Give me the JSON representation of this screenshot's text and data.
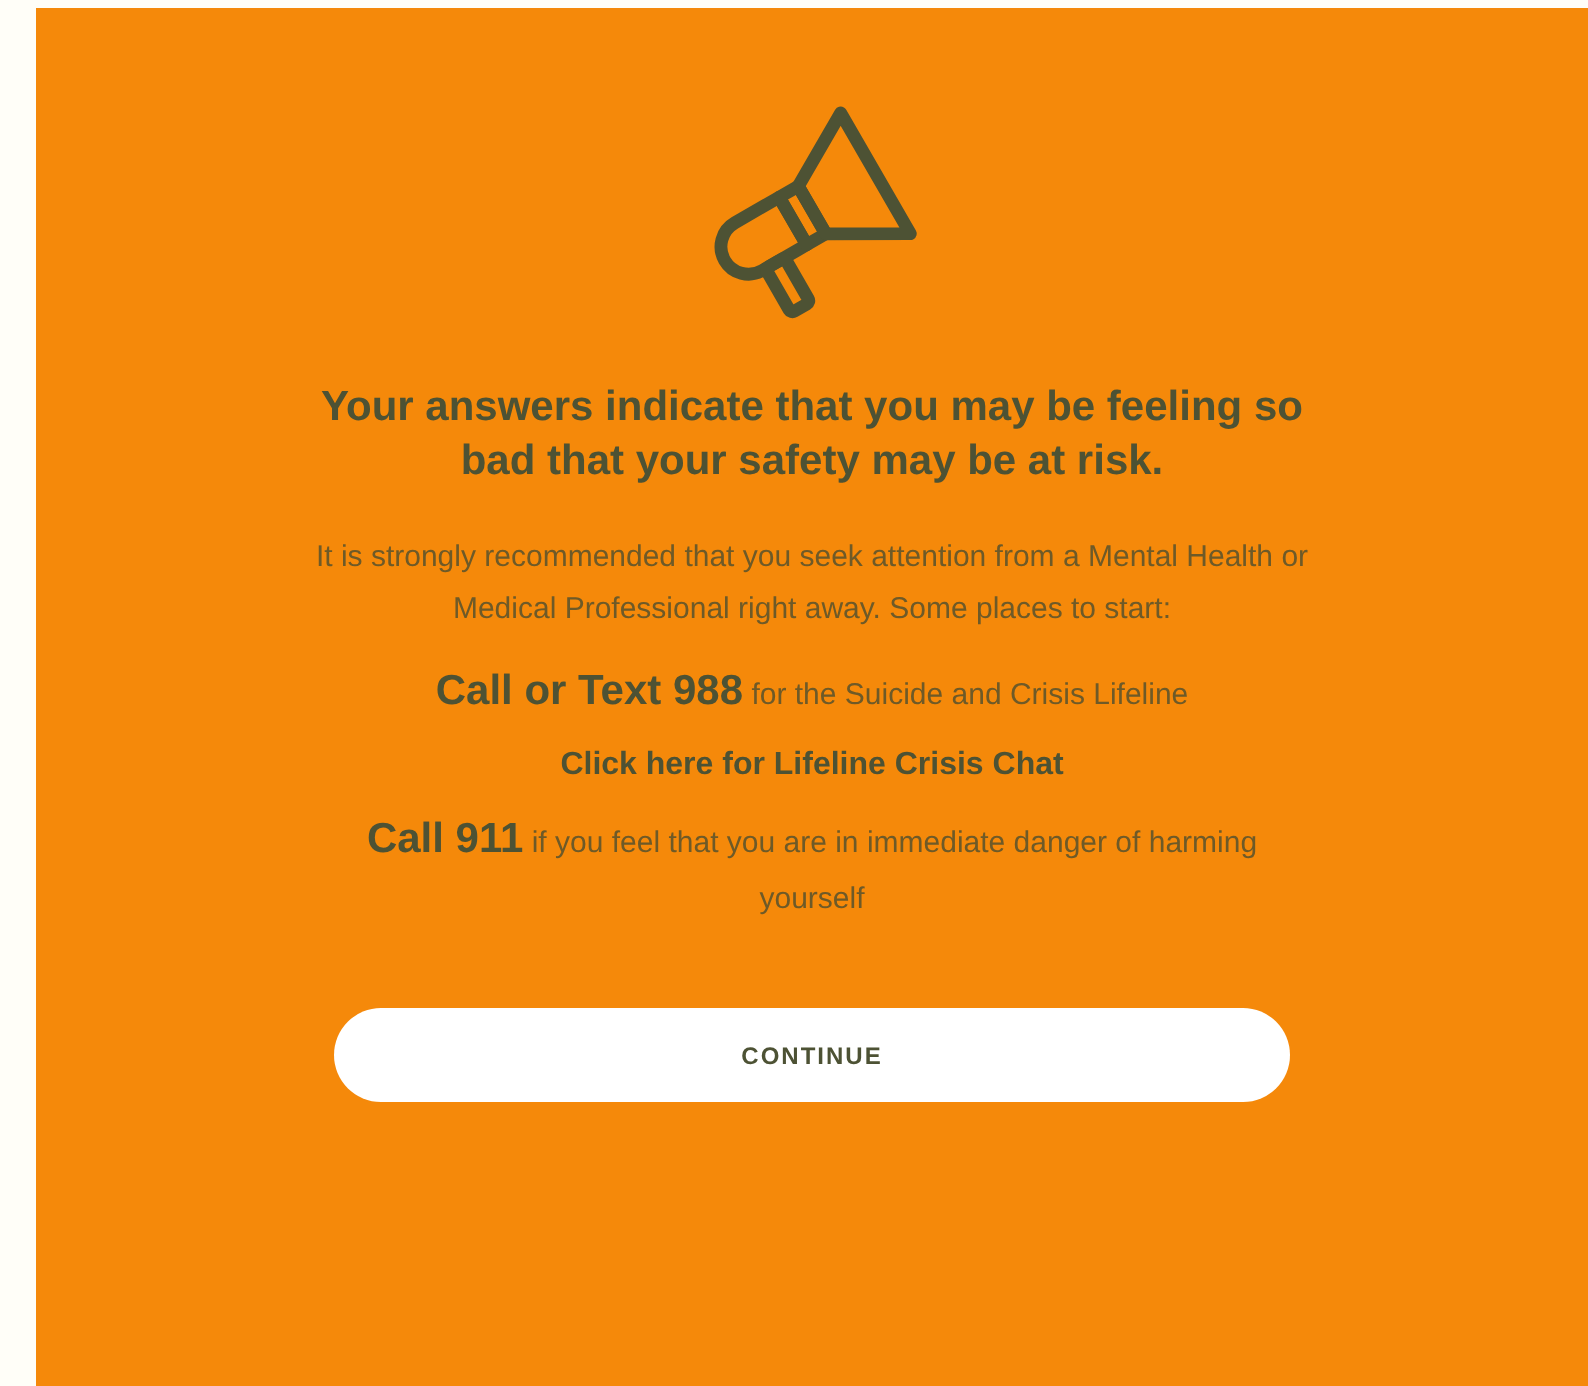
{
  "heading": "Your answers indicate that you may be feeling so bad that your safety may be at risk.",
  "intro": "It is strongly recommended that you seek attention from a Mental Health or Medical Professional right away. Some places to start:",
  "resources": [
    {
      "kind": "text",
      "text": "**Call or Text 988** for the Suicide and Crisis Lifeline"
    },
    {
      "kind": "link",
      "text": "Click here for Lifeline Crisis Chat"
    },
    {
      "kind": "text",
      "text": "**Call 911** if you feel that you are in immediate danger of harming yourself"
    }
  ],
  "button": "CONTINUE"
}
